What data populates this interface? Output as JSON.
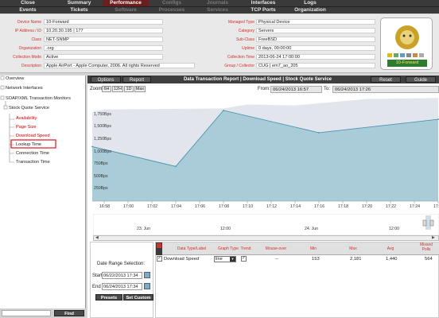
{
  "nav": {
    "row1": [
      {
        "label": "Close",
        "on": false,
        "dim": false
      },
      {
        "label": "Summary",
        "on": false,
        "dim": false
      },
      {
        "label": "Performance",
        "on": true,
        "dim": false
      },
      {
        "label": "Configs",
        "on": false,
        "dim": true
      },
      {
        "label": "Journals",
        "on": false,
        "dim": true
      },
      {
        "label": "Interfaces",
        "on": false,
        "dim": false
      },
      {
        "label": "Logs",
        "on": false,
        "dim": false
      }
    ],
    "row2": [
      {
        "label": "Events",
        "on": false,
        "dim": false
      },
      {
        "label": "Tickets",
        "on": false,
        "dim": false
      },
      {
        "label": "Software",
        "on": false,
        "dim": true
      },
      {
        "label": "Processes",
        "on": false,
        "dim": true
      },
      {
        "label": "Services",
        "on": false,
        "dim": true
      },
      {
        "label": "TCP Ports",
        "on": false,
        "dim": false
      },
      {
        "label": "Organization",
        "on": false,
        "dim": false
      }
    ]
  },
  "info": {
    "left": [
      {
        "label": "Device Name",
        "value": "10-Forward"
      },
      {
        "label": "IP Address / ID",
        "value": "10.20.30.195 | 177"
      },
      {
        "label": "Class",
        "value": "NET-SNMP"
      },
      {
        "label": "Organization",
        "value": ".org"
      },
      {
        "label": "Collection Mode",
        "value": "Active"
      },
      {
        "label": "Description",
        "value": "Apple AirPort - Apple Computer, 2006. All rights Reserved"
      }
    ],
    "right": [
      {
        "label": "Managed Type",
        "value": "Physical Device"
      },
      {
        "label": "Category",
        "value": "Servers"
      },
      {
        "label": "Sub-Class",
        "value": "FreeBSD"
      },
      {
        "label": "Uptime",
        "value": "0 days, 00:00:00"
      },
      {
        "label": "Collection Time",
        "value": "2013-06-24 17:00:00"
      },
      {
        "label": "Group / Collector",
        "value": "CUG | em7_ao_205"
      }
    ],
    "device_badge": "10-Forward"
  },
  "tree": {
    "items": [
      "Overview",
      "Network Interfaces",
      "SOAP/XML Transaction Monitors",
      "Stock Quote Service",
      "Availability",
      "Page Size",
      "Download Speed",
      "Lookup Time",
      "Connection Time",
      "Transaction Time"
    ],
    "find_label": "Find"
  },
  "toolbar": {
    "options": "Options",
    "report": "Report",
    "title": "Data Transaction Report | Download Speed | Stock Quote Service",
    "reset": "Reset",
    "guide": "Guide"
  },
  "zoom": {
    "label": "Zoom",
    "buttons": [
      "6H",
      "12H",
      "1D",
      "Max"
    ],
    "from_label": "From:",
    "from_value": "06/24/2013 16:57",
    "to_label": "To:",
    "to_value": "06/24/2013 17:26"
  },
  "chart_data": {
    "type": "line",
    "title": "",
    "ylabel": "",
    "y_ticks": [
      "250Bps",
      "500Bps",
      "750Bps",
      "1,000Bps",
      "1,250Bps",
      "1,500Bps",
      "1,750Bps"
    ],
    "ylim": [
      0,
      2100
    ],
    "x_ticks": [
      "16:58",
      "17:00",
      "17:02",
      "17:04",
      "17:06",
      "17:08",
      "17:10",
      "17:12",
      "17:14",
      "17:16",
      "17:18",
      "17:20",
      "17:22",
      "17:24",
      "17:26"
    ],
    "series": [
      {
        "name": "Download Speed",
        "x": [
          "16:57",
          "17:04",
          "17:08",
          "17:16",
          "17:26"
        ],
        "values": [
          1100,
          700,
          1830,
          1380,
          1650
        ]
      }
    ],
    "navigator": {
      "labels": [
        "23. Jun",
        "12:00",
        "24. Jun",
        "12:00"
      ]
    }
  },
  "range": {
    "title": "Date Range Selection:",
    "start_label": "Start",
    "start_value": "06/22/2013 17:34",
    "end_label": "End",
    "end_value": "06/24/2013 17:34",
    "presets": "Presets",
    "custom": "Set Custom"
  },
  "table": {
    "headers": [
      "Data Type/Label",
      "Graph Type",
      "Trend",
      "Mouse-over",
      "Min",
      "Max",
      "Avg",
      "Missed Polls"
    ],
    "row": {
      "label": "Download Speed",
      "graph_type": "line",
      "mouseover": "--",
      "min": "153",
      "max": "2,181",
      "avg": "1,440",
      "missed": "564"
    }
  }
}
